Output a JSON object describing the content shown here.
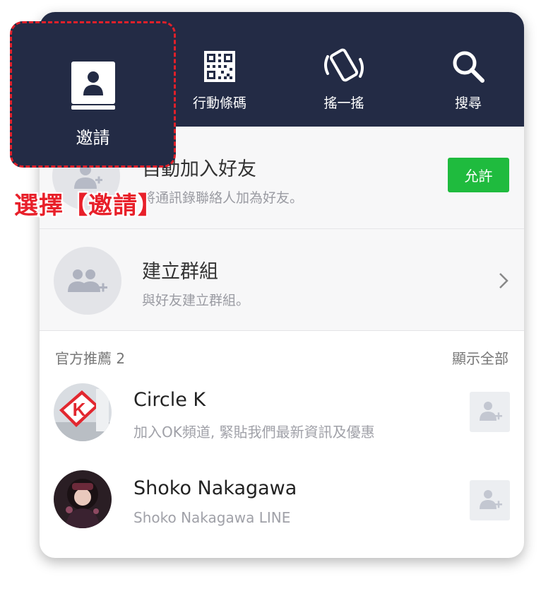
{
  "nav": {
    "invite_label": "邀請",
    "qrcode_label": "行動條碼",
    "shake_label": "搖一搖",
    "search_label": "搜尋"
  },
  "auto_add": {
    "title": "自動加入好友",
    "subtitle": "將通訊錄聯絡人加為好友。",
    "button_label": "允許"
  },
  "create_group": {
    "title": "建立群組",
    "subtitle": "與好友建立群組。"
  },
  "recommended": {
    "header": "官方推薦 2",
    "show_all": "顯示全部",
    "items": [
      {
        "name": "Circle K",
        "description": "加入OK頻道, 緊貼我們最新資訊及優惠"
      },
      {
        "name": "Shoko Nakagawa",
        "description": "Shoko Nakagawa LINE"
      }
    ]
  },
  "annotation": "選擇【邀請】",
  "colors": {
    "topbar": "#232b45",
    "allow_green": "#1fbb3e",
    "annotation_red": "#e8202a"
  }
}
